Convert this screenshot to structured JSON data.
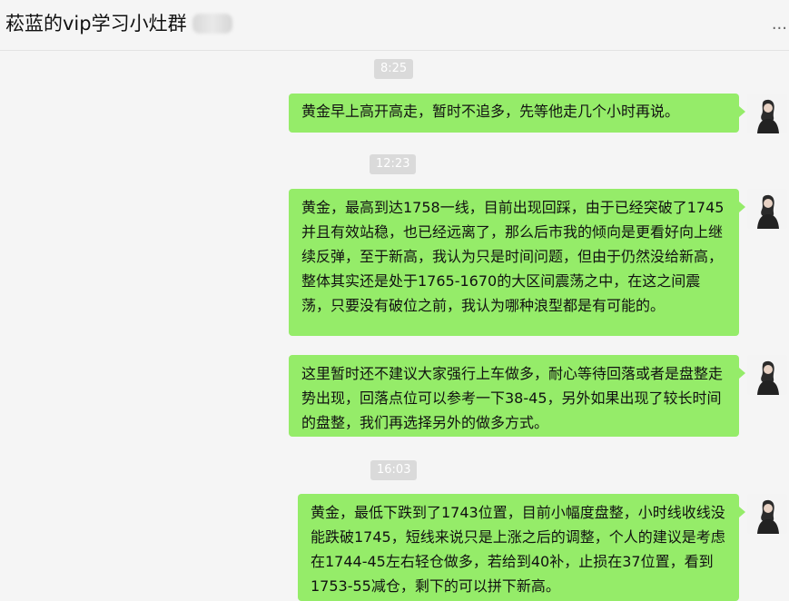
{
  "header": {
    "title": "菘蓝的vip学习小灶群",
    "more_icon": "..."
  },
  "messages": [
    {
      "time": "8:25",
      "text": "黄金早上高开高走，暂时不追多，先等他走几个小时再说。"
    },
    {
      "time": "12:23",
      "text": "黄金，最高到达1758一线，目前出现回踩，由于已经突破了1745并且有效站稳，也已经远离了，那么后市我的倾向是更看好向上继续反弹，至于新高，我认为只是时间问题，但由于仍然没给新高，整体其实还是处于1765-1670的大区间震荡之中，在这之间震荡，只要没有破位之前，我认为哪种浪型都是有可能的。"
    },
    {
      "time": "",
      "text": "这里暂时还不建议大家强行上车做多，耐心等待回落或者是盘整走势出现，回落点位可以参考一下38-45，另外如果出现了较长时间的盘整，我们再选择另外的做多方式。"
    },
    {
      "time": "16:03",
      "text": "黄金，最低下跌到了1743位置，目前小幅度盘整，小时线收线没能跌破1745，短线来说只是上涨之后的调整，个人的建议是考虑在1744-45左右轻仓做多，若给到40补，止损在37位置，看到1753-55减仓，剩下的可以拼下新高。"
    }
  ]
}
